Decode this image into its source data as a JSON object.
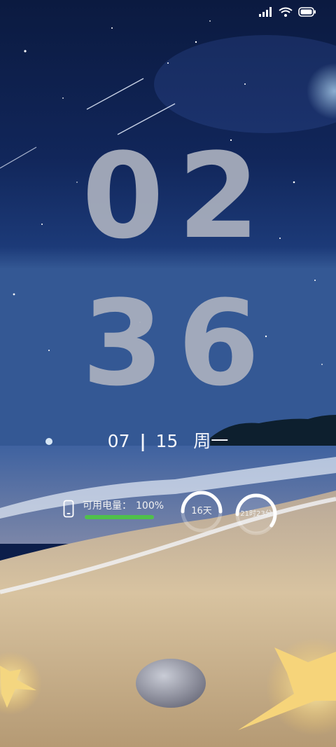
{
  "status": {
    "signal_icon": "signal-bars-icon",
    "wifi_icon": "wifi-icon",
    "battery_icon": "battery-icon"
  },
  "clock": {
    "hours": "02",
    "minutes": "36"
  },
  "date": {
    "month": "07",
    "separator": "|",
    "day": "15",
    "weekday": "周一"
  },
  "battery_widget": {
    "icon": "phone-icon",
    "label": "可用电量：",
    "value": "100%",
    "level": 1.0,
    "bar_color": "#4fc04b"
  },
  "rings": {
    "days": {
      "text": "16天",
      "progress": 0.5
    },
    "time": {
      "text": "21时23分",
      "progress": 0.6
    }
  },
  "wallpaper": {
    "sky_color": "#0c1e4a",
    "sand_color": "#d9c39d",
    "sea_color": "#3b5a92"
  }
}
